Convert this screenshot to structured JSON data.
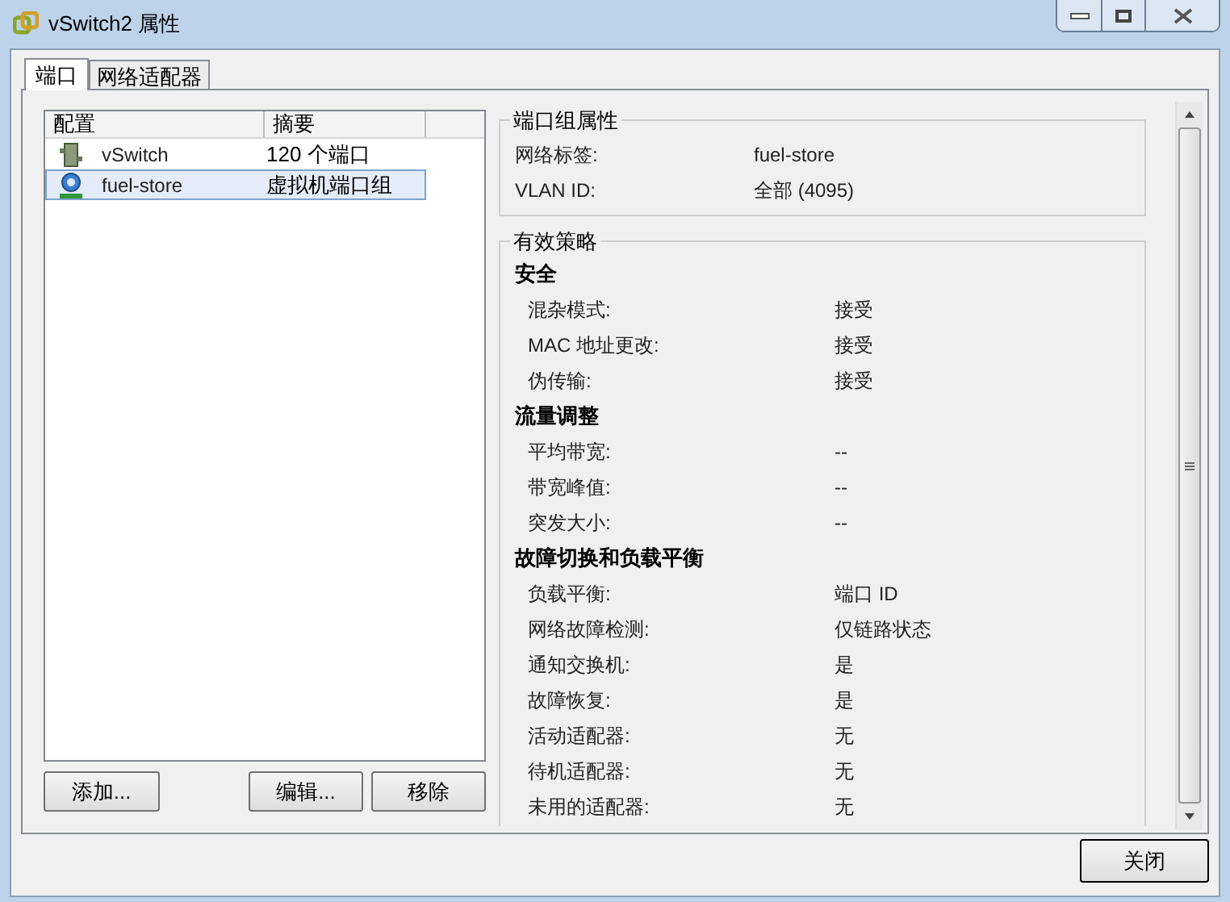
{
  "window": {
    "title": "vSwitch2 属性"
  },
  "tabs": [
    {
      "label": "端口",
      "selected": true
    },
    {
      "label": "网络适配器",
      "selected": false
    }
  ],
  "list": {
    "columns": [
      "配置",
      "摘要"
    ],
    "rows": [
      {
        "kind": "switch",
        "name": "vSwitch",
        "summary": "120 个端口",
        "selected": false
      },
      {
        "kind": "portgroup",
        "name": "fuel-store",
        "summary": "虚拟机端口组",
        "selected": true
      }
    ]
  },
  "list_buttons": [
    "添加...",
    "编辑...",
    "移除"
  ],
  "port_group": {
    "title": "端口组属性",
    "rows": [
      {
        "label": "网络标签:",
        "value": "fuel-store"
      },
      {
        "label": "VLAN ID:",
        "value": "全部 (4095)"
      }
    ]
  },
  "policy": {
    "title": "有效策略",
    "rows": [
      {
        "kind": "heading",
        "label": "安全"
      },
      {
        "kind": "row",
        "label": "混杂模式:",
        "value": "接受"
      },
      {
        "kind": "row",
        "label": "MAC 地址更改:",
        "value": "接受"
      },
      {
        "kind": "row",
        "label": "伪传输:",
        "value": "接受"
      },
      {
        "kind": "heading",
        "label": "流量调整"
      },
      {
        "kind": "row",
        "label": "平均带宽:",
        "value": "--"
      },
      {
        "kind": "row",
        "label": "带宽峰值:",
        "value": "--"
      },
      {
        "kind": "row",
        "label": "突发大小:",
        "value": "--"
      },
      {
        "kind": "heading",
        "label": "故障切换和负载平衡"
      },
      {
        "kind": "row",
        "label": "负载平衡:",
        "value": "端口 ID"
      },
      {
        "kind": "row",
        "label": "网络故障检测:",
        "value": "仅链路状态"
      },
      {
        "kind": "row",
        "label": "通知交换机:",
        "value": "是"
      },
      {
        "kind": "row",
        "label": "故障恢复:",
        "value": "是"
      },
      {
        "kind": "row",
        "label": "活动适配器:",
        "value": "无"
      },
      {
        "kind": "row",
        "label": "待机适配器:",
        "value": "无"
      },
      {
        "kind": "row",
        "label": "未用的适配器:",
        "value": "无"
      }
    ]
  },
  "close_button": "关闭"
}
